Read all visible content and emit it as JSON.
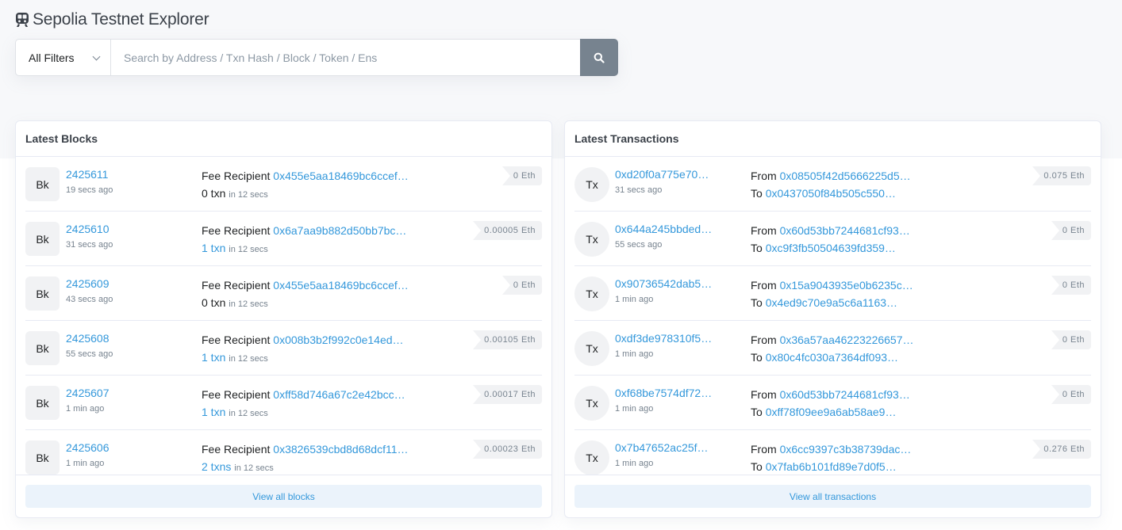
{
  "header": {
    "title": "Sepolia Testnet Explorer",
    "logo_icon": "train-icon"
  },
  "search": {
    "filter_selected": "All Filters",
    "placeholder": "Search by Address / Txn Hash / Block / Token / Ens",
    "value": "",
    "button_icon": "search-icon"
  },
  "blocks": {
    "title": "Latest Blocks",
    "fee_label": "Fee Recipient",
    "badge": "Bk",
    "items": [
      {
        "number": "2425611",
        "age": "19 secs ago",
        "recipient": "0x455e5aa18469bc6ccef…",
        "txn": "0 txn",
        "txn_link": false,
        "duration": "in 12 secs",
        "reward": "0 Eth"
      },
      {
        "number": "2425610",
        "age": "31 secs ago",
        "recipient": "0x6a7aa9b882d50bb7bc…",
        "txn": "1 txn",
        "txn_link": true,
        "duration": "in 12 secs",
        "reward": "0.00005 Eth"
      },
      {
        "number": "2425609",
        "age": "43 secs ago",
        "recipient": "0x455e5aa18469bc6ccef…",
        "txn": "0 txn",
        "txn_link": false,
        "duration": "in 12 secs",
        "reward": "0 Eth"
      },
      {
        "number": "2425608",
        "age": "55 secs ago",
        "recipient": "0x008b3b2f992c0e14ed…",
        "txn": "1 txn",
        "txn_link": true,
        "duration": "in 12 secs",
        "reward": "0.00105 Eth"
      },
      {
        "number": "2425607",
        "age": "1 min ago",
        "recipient": "0xff58d746a67c2e42bcc…",
        "txn": "1 txn",
        "txn_link": true,
        "duration": "in 12 secs",
        "reward": "0.00017 Eth"
      },
      {
        "number": "2425606",
        "age": "1 min ago",
        "recipient": "0x3826539cbd8d68dcf11…",
        "txn": "2 txns",
        "txn_link": true,
        "duration": "in 12 secs",
        "reward": "0.00023 Eth"
      }
    ],
    "view_all": "View all blocks"
  },
  "transactions": {
    "title": "Latest Transactions",
    "from_label": "From",
    "to_label": "To",
    "badge": "Tx",
    "items": [
      {
        "hash": "0xd20f0a775e70…",
        "age": "31 secs ago",
        "from": "0x08505f42d5666225d5…",
        "to": "0x0437050f84b505c550…",
        "value": "0.075 Eth"
      },
      {
        "hash": "0x644a245bbded…",
        "age": "55 secs ago",
        "from": "0x60d53bb7244681cf93…",
        "to": "0xc9f3fb50504639fd359…",
        "value": "0 Eth"
      },
      {
        "hash": "0x90736542dab5…",
        "age": "1 min ago",
        "from": "0x15a9043935e0b6235c…",
        "to": "0x4ed9c70e9a5c6a1163…",
        "value": "0 Eth"
      },
      {
        "hash": "0xdf3de978310f5…",
        "age": "1 min ago",
        "from": "0x36a57aa46223226657…",
        "to": "0x80c4fc030a7364df093…",
        "value": "0 Eth"
      },
      {
        "hash": "0xf68be7574df72…",
        "age": "1 min ago",
        "from": "0x60d53bb7244681cf93…",
        "to": "0xff78f09ee9a6ab58ae9…",
        "value": "0 Eth"
      },
      {
        "hash": "0x7b47652ac25f…",
        "age": "1 min ago",
        "from": "0x6cc9397c3b38739dac…",
        "to": "0x7fab6b101fd89e7d0f5…",
        "value": "0.276 Eth"
      }
    ],
    "view_all": "View all transactions"
  }
}
